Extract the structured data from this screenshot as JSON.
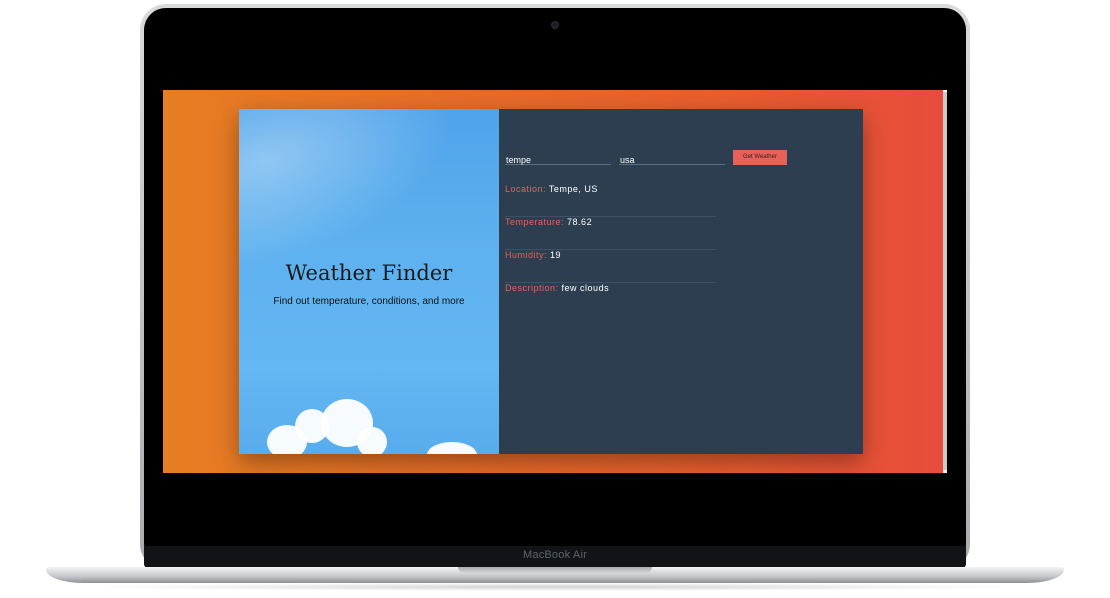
{
  "device": {
    "brand": "MacBook Air"
  },
  "app": {
    "title": "Weather Finder",
    "subtitle": "Find out temperature, conditions, and more"
  },
  "form": {
    "city_value": "tempe",
    "country_value": "usa",
    "submit_label": "Get Weather"
  },
  "results": {
    "location": {
      "label": "Location:",
      "value": "Tempe, US"
    },
    "temperature": {
      "label": "Temperature:",
      "value": "78.62"
    },
    "humidity": {
      "label": "Humidity:",
      "value": "19"
    },
    "description": {
      "label": "Description:",
      "value": "few clouds"
    }
  },
  "colors": {
    "background_start": "#e67e22",
    "background_end": "#e74c3c",
    "panel": "#2c3e50",
    "accent": "#e8605a",
    "sky": "#5eb1ef"
  }
}
